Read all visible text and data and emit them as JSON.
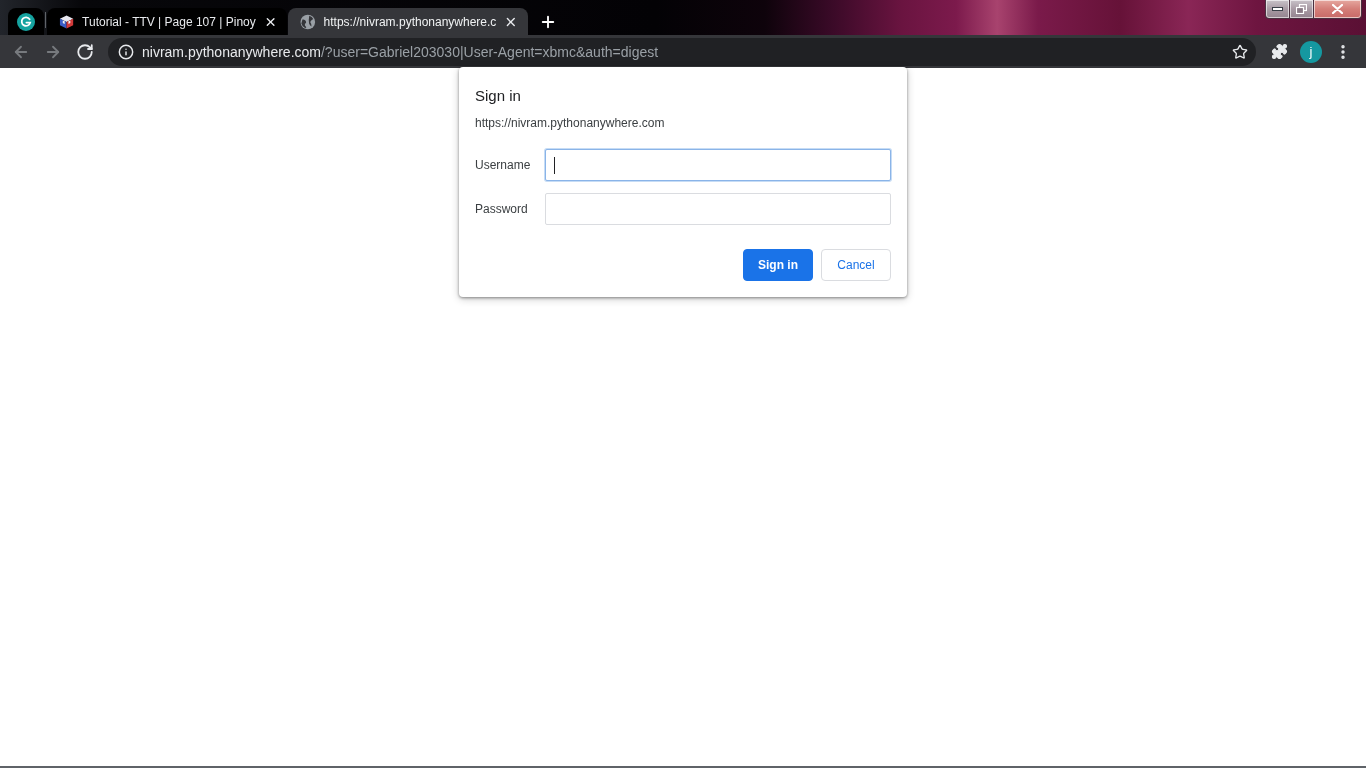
{
  "tabs": [
    {
      "kind": "pinned",
      "selected": false
    },
    {
      "kind": "normal",
      "title": "Tutorial - TTV | Page 107 | Pinoy",
      "selected": false
    },
    {
      "kind": "normal",
      "title": "https://nivram.pythonanywhere.c",
      "selected": true
    }
  ],
  "toolbar": {
    "nav_buttons": [
      {
        "kind": "back",
        "disabled": true
      },
      {
        "kind": "forward",
        "disabled": true
      },
      {
        "kind": "reload",
        "disabled": false
      }
    ],
    "address_bar": {
      "host": "nivram.pythonanywhere.com",
      "path": "/?user=Gabriel203030|User-Agent=xbmc&auth=digest"
    },
    "profile": {
      "initial": "j"
    }
  },
  "dialog": {
    "title": "Sign in",
    "origin": "https://nivram.pythonanywhere.com",
    "fields": [
      {
        "label": "Username",
        "focused": true
      },
      {
        "label": "Password",
        "focused": false
      }
    ],
    "buttons": [
      {
        "kind": "primary",
        "label": "Sign in"
      },
      {
        "kind": "secondary",
        "label": "Cancel"
      }
    ]
  }
}
